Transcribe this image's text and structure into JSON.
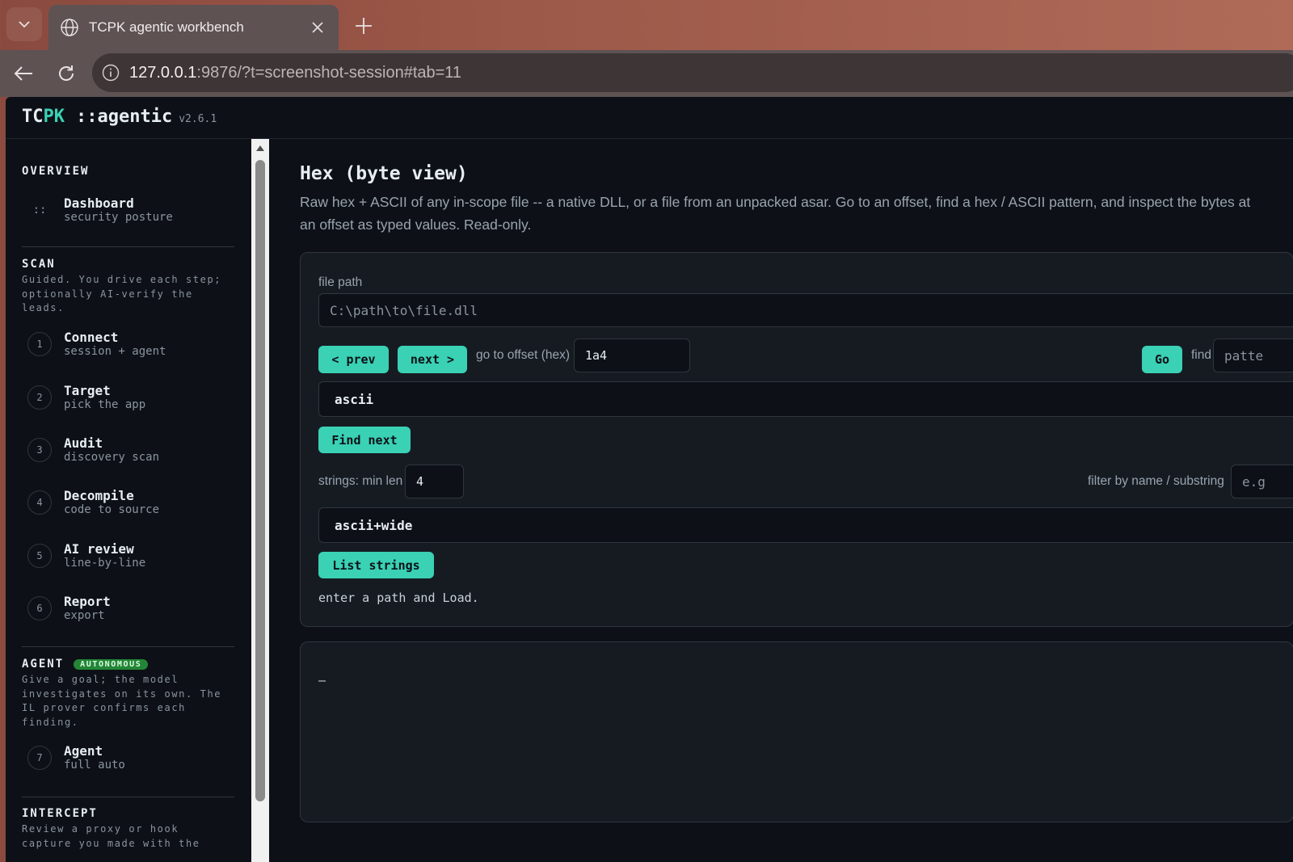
{
  "browser": {
    "tab_title": "TCPK agentic workbench",
    "url_host": "127.0.0.1",
    "url_rest": ":9876/?t=screenshot-session#tab=11"
  },
  "header": {
    "brand_a": "TC",
    "brand_b": "PK",
    "brand_sub": "::agentic",
    "version": "v2.6.1"
  },
  "sidebar": {
    "overview": {
      "title": "OVERVIEW",
      "items": [
        {
          "icon": "::",
          "label": "Dashboard",
          "sub": "security posture"
        }
      ]
    },
    "scan": {
      "title": "SCAN",
      "desc": "Guided. You drive each step; optionally AI-verify the leads.",
      "items": [
        {
          "num": "1",
          "label": "Connect",
          "sub": "session + agent"
        },
        {
          "num": "2",
          "label": "Target",
          "sub": "pick the app"
        },
        {
          "num": "3",
          "label": "Audit",
          "sub": "discovery scan"
        },
        {
          "num": "4",
          "label": "Decompile",
          "sub": "code to source"
        },
        {
          "num": "5",
          "label": "AI review",
          "sub": "line-by-line"
        },
        {
          "num": "6",
          "label": "Report",
          "sub": "export"
        }
      ]
    },
    "agent": {
      "title": "AGENT",
      "badge": "AUTONOMOUS",
      "desc": "Give a goal; the model investigates on its own. The IL prover confirms each finding.",
      "items": [
        {
          "num": "7",
          "label": "Agent",
          "sub": "full auto"
        }
      ]
    },
    "intercept": {
      "title": "INTERCEPT",
      "desc": "Review a proxy or hook capture you made with the"
    }
  },
  "main": {
    "title": "Hex (byte view)",
    "description": "Raw hex + ASCII of any in-scope file -- a native DLL, or a file from an unpacked asar. Go to an offset, find a hex / ASCII pattern, and inspect the bytes at an offset as typed values. Read-only.",
    "file_path_label": "file path",
    "file_path_placeholder": "C:\\path\\to\\file.dll",
    "prev_label": "< prev",
    "next_label": "next >",
    "offset_label": "go to offset (hex)",
    "offset_value": "1a4",
    "go_label": "Go",
    "find_label": "find",
    "find_placeholder": "patte",
    "find_mode": "ascii",
    "find_next_label": "Find next",
    "strings_minlen_label": "strings: min len",
    "strings_minlen_value": "4",
    "filter_label": "filter by name / substring",
    "filter_placeholder": "e.g",
    "strings_mode": "ascii+wide",
    "list_strings_label": "List strings",
    "status": "enter a path and Load.",
    "output": "–"
  }
}
